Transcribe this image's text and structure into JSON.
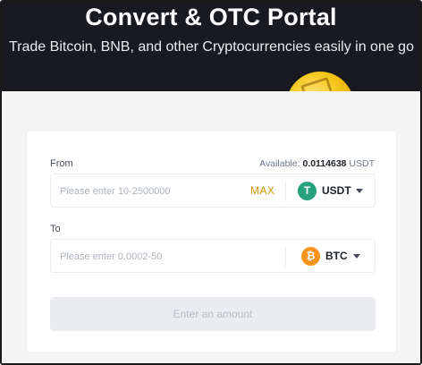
{
  "hero": {
    "title": "Convert & OTC Portal",
    "subtitle": "Trade Bitcoin, BNB, and other Cryptocurrencies easily in one go"
  },
  "convert": {
    "from": {
      "label": "From",
      "available_label": "Available: ",
      "available_amount": "0.0114638",
      "available_unit": " USDT",
      "placeholder": "Please enter 10-2500000",
      "max_label": "MAX",
      "coin": "USDT",
      "coin_icon": "tether-icon",
      "coin_glyph": "T",
      "coin_color": "#26a17b"
    },
    "to": {
      "label": "To",
      "placeholder": "Please enter 0.0002-50",
      "coin": "BTC",
      "coin_icon": "bitcoin-icon",
      "coin_glyph": "₿",
      "coin_color": "#f7931a"
    },
    "submit_label": "Enter an amount"
  },
  "colors": {
    "hero_bg": "#181a20",
    "accent": "#c99400",
    "button_disabled_bg": "#eaecef",
    "button_disabled_text": "#b7bdc6"
  }
}
